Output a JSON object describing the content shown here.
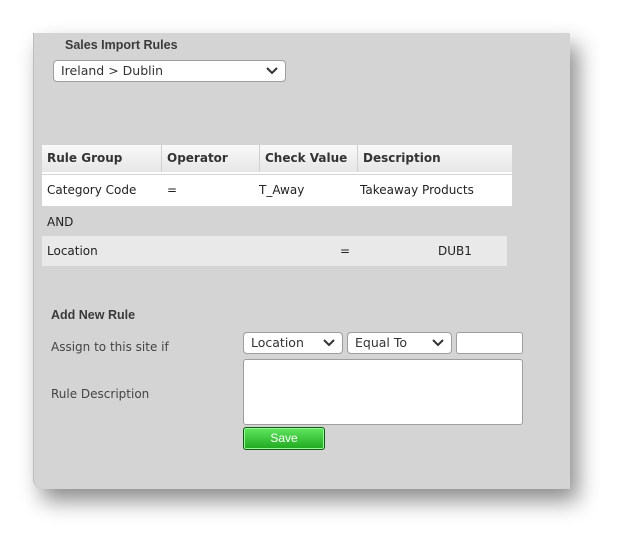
{
  "sales_import": {
    "title": "Sales Import Rules",
    "site_select_value": "Ireland > Dublin"
  },
  "rules_table": {
    "headers": [
      "Rule Group",
      "Operator",
      "Check Value",
      "Description"
    ],
    "rule1": {
      "group": "Category Code",
      "operator": "=",
      "check_value": "T_Away",
      "description": "Takeaway Products"
    },
    "joiner": "AND",
    "rule2": {
      "group": "Location",
      "operator": "=",
      "check_value": "DUB1"
    }
  },
  "add_rule": {
    "title": "Add New Rule",
    "assign_label": "Assign to this site if",
    "field_select_value": "Location",
    "operator_select_value": "Equal To",
    "value_input": "",
    "description_label": "Rule Description",
    "description_value": "",
    "save_label": "Save"
  },
  "colors": {
    "panel": "#d4d4d4",
    "save_button": "#2fbf2f"
  },
  "icons": [
    "chevron-down-icon"
  ]
}
